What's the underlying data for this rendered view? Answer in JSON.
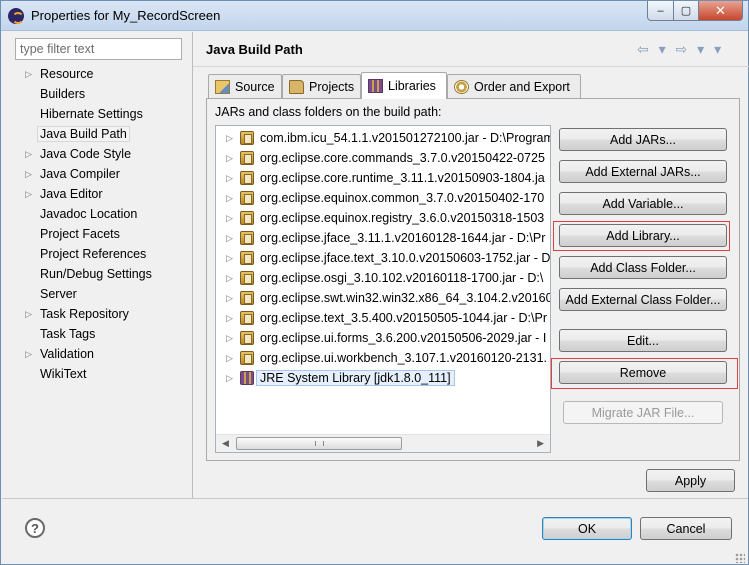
{
  "window": {
    "title": "Properties for My_RecordScreen",
    "close_label": "✕",
    "minimize_label": "–",
    "maximize_label": "▢"
  },
  "sidebar": {
    "filter_placeholder": "type filter text",
    "items": [
      {
        "label": "Resource",
        "expandable": true
      },
      {
        "label": "Builders",
        "expandable": false
      },
      {
        "label": "Hibernate Settings",
        "expandable": false
      },
      {
        "label": "Java Build Path",
        "expandable": false,
        "selected": true
      },
      {
        "label": "Java Code Style",
        "expandable": true
      },
      {
        "label": "Java Compiler",
        "expandable": true
      },
      {
        "label": "Java Editor",
        "expandable": true
      },
      {
        "label": "Javadoc Location",
        "expandable": false
      },
      {
        "label": "Project Facets",
        "expandable": false
      },
      {
        "label": "Project References",
        "expandable": false
      },
      {
        "label": "Run/Debug Settings",
        "expandable": false
      },
      {
        "label": "Server",
        "expandable": false
      },
      {
        "label": "Task Repository",
        "expandable": true
      },
      {
        "label": "Task Tags",
        "expandable": false
      },
      {
        "label": "Validation",
        "expandable": true
      },
      {
        "label": "WikiText",
        "expandable": false
      }
    ]
  },
  "page": {
    "title": "Java Build Path",
    "nav_arrows": "⇦ ▾ ⇨ ▾ ▾",
    "tabs": [
      {
        "label": "Source",
        "icon": "source-folder-icon"
      },
      {
        "label": "Projects",
        "icon": "project-folder-icon"
      },
      {
        "label": "Libraries",
        "icon": "library-icon",
        "active": true
      },
      {
        "label": "Order and Export",
        "icon": "order-export-icon"
      }
    ],
    "list_label": "JARs and class folders on the build path:",
    "entries": [
      "com.ibm.icu_54.1.1.v201501272100.jar - D:\\Program",
      "org.eclipse.core.commands_3.7.0.v20150422-0725",
      "org.eclipse.core.runtime_3.11.1.v20150903-1804.ja",
      "org.eclipse.equinox.common_3.7.0.v20150402-170",
      "org.eclipse.equinox.registry_3.6.0.v20150318-1503",
      "org.eclipse.jface_3.11.1.v20160128-1644.jar - D:\\Pr",
      "org.eclipse.jface.text_3.10.0.v20150603-1752.jar - D",
      "org.eclipse.osgi_3.10.102.v20160118-1700.jar - D:\\",
      "org.eclipse.swt.win32.win32.x86_64_3.104.2.v20160",
      "org.eclipse.text_3.5.400.v20150505-1044.jar - D:\\Pr",
      "org.eclipse.ui.forms_3.6.200.v20150506-2029.jar - I",
      "org.eclipse.ui.workbench_3.107.1.v20160120-2131."
    ],
    "jre_entry": "JRE System Library [jdk1.8.0_111]",
    "buttons": {
      "add_jars": "Add JARs...",
      "add_external_jars": "Add External JARs...",
      "add_variable": "Add Variable...",
      "add_library": "Add Library...",
      "add_class_folder": "Add Class Folder...",
      "add_external_class_folder": "Add External Class Folder...",
      "edit": "Edit...",
      "remove": "Remove",
      "migrate_jar": "Migrate JAR File..."
    },
    "apply": "Apply"
  },
  "footer": {
    "help": "?",
    "ok": "OK",
    "cancel": "Cancel"
  },
  "colors": {
    "highlight_box": "#e14040",
    "selection": "#e6f0fc"
  }
}
